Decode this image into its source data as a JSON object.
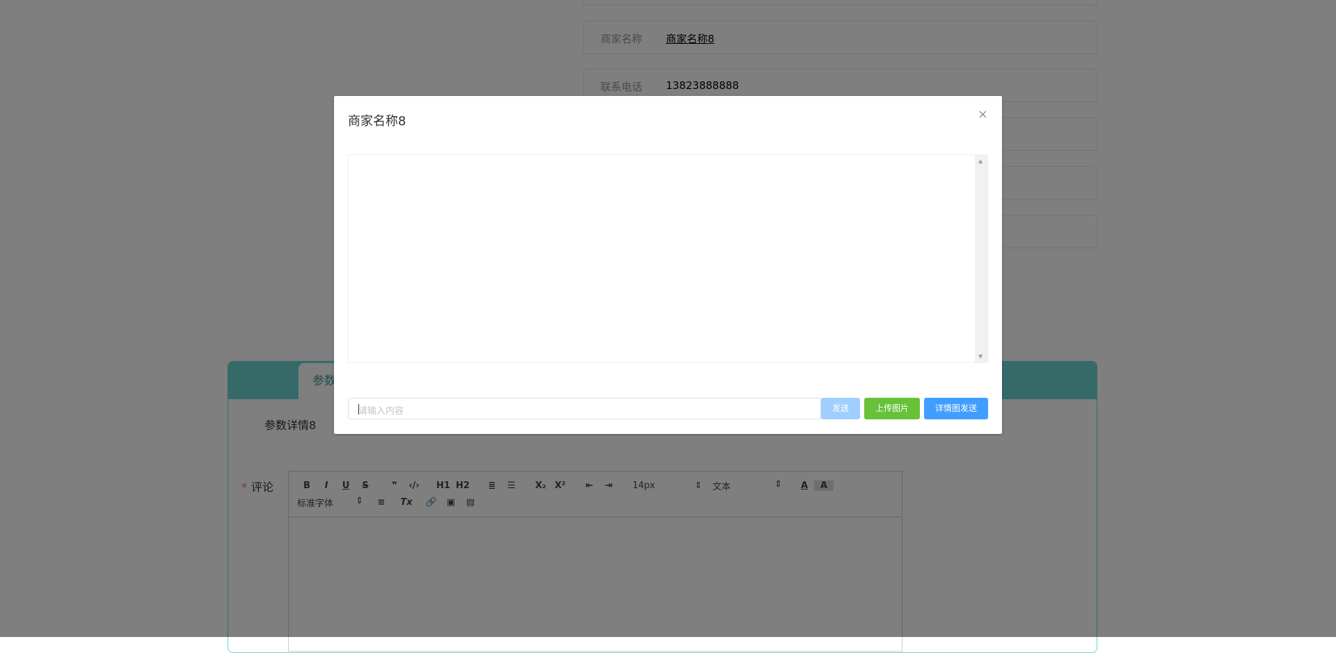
{
  "info": [
    {
      "label": "商家名称",
      "value": "商家名称8",
      "link": true
    },
    {
      "label": "联系电话",
      "value": "13823888888"
    }
  ],
  "card": {
    "tab_label": "参数",
    "param_text": "参数详情8",
    "comment_label": "评论",
    "required_mark": "*",
    "toolbar": {
      "row1": [
        "B",
        "I",
        "U",
        "S",
        "❞",
        "‹/›",
        "H1",
        "H2",
        "≣",
        "☰",
        "X₂",
        "X²",
        "⇤",
        "⇥"
      ],
      "size_select": "14px",
      "header_select": "文本",
      "row2_font_select": "标准字体",
      "row2": [
        "≡",
        "Tx",
        "🔗",
        "▣",
        "▤"
      ]
    }
  },
  "modal": {
    "title": "商家名称8",
    "close": "×",
    "input_placeholder": "请输入内容",
    "send": "发送",
    "upload": "上传图片",
    "detail_send": "详情图发送",
    "colors": {
      "send_disabled": "#a0cfff",
      "upload": "#67c23a",
      "detail_send": "#409eff"
    }
  }
}
